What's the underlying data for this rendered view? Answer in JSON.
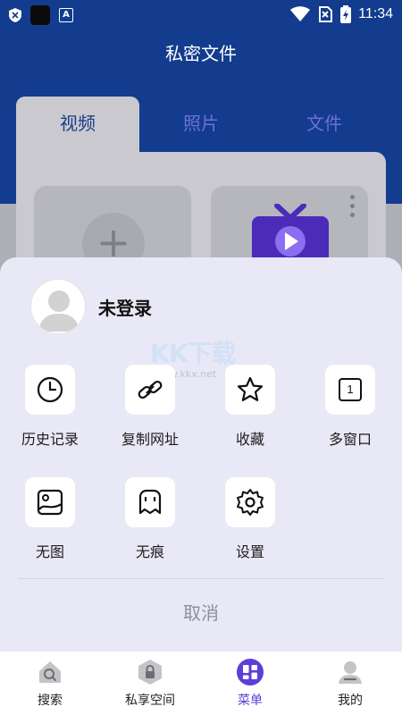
{
  "status_bar": {
    "time": "11:34"
  },
  "page": {
    "title": "私密文件",
    "tabs": [
      {
        "label": "视频",
        "active": true
      },
      {
        "label": "照片",
        "active": false
      },
      {
        "label": "文件",
        "active": false
      }
    ]
  },
  "sheet": {
    "user": {
      "name": "未登录"
    },
    "watermark": {
      "logo": "KK下载",
      "url": "www.kkx.net"
    },
    "menu": [
      {
        "label": "历史记录",
        "icon": "clock-icon"
      },
      {
        "label": "复制网址",
        "icon": "link-icon"
      },
      {
        "label": "收藏",
        "icon": "star-icon"
      },
      {
        "label": "多窗口",
        "icon": "window-count-icon",
        "badge": "1"
      },
      {
        "label": "无图",
        "icon": "image-icon"
      },
      {
        "label": "无痕",
        "icon": "ghost-icon"
      },
      {
        "label": "设置",
        "icon": "gear-icon"
      }
    ],
    "cancel_label": "取消"
  },
  "bottom_nav": [
    {
      "label": "搜索",
      "icon": "search-home-icon",
      "active": false
    },
    {
      "label": "私享空间",
      "icon": "lock-icon",
      "active": false
    },
    {
      "label": "菜单",
      "icon": "menu-grid-icon",
      "active": true
    },
    {
      "label": "我的",
      "icon": "profile-icon",
      "active": false
    }
  ],
  "colors": {
    "header_bg": "#133c8e",
    "sheet_bg": "#e9e8f6",
    "accent": "#5b3fd6",
    "tab_active_text": "#1c3c86",
    "tab_inactive_text": "#6f6fd6"
  }
}
